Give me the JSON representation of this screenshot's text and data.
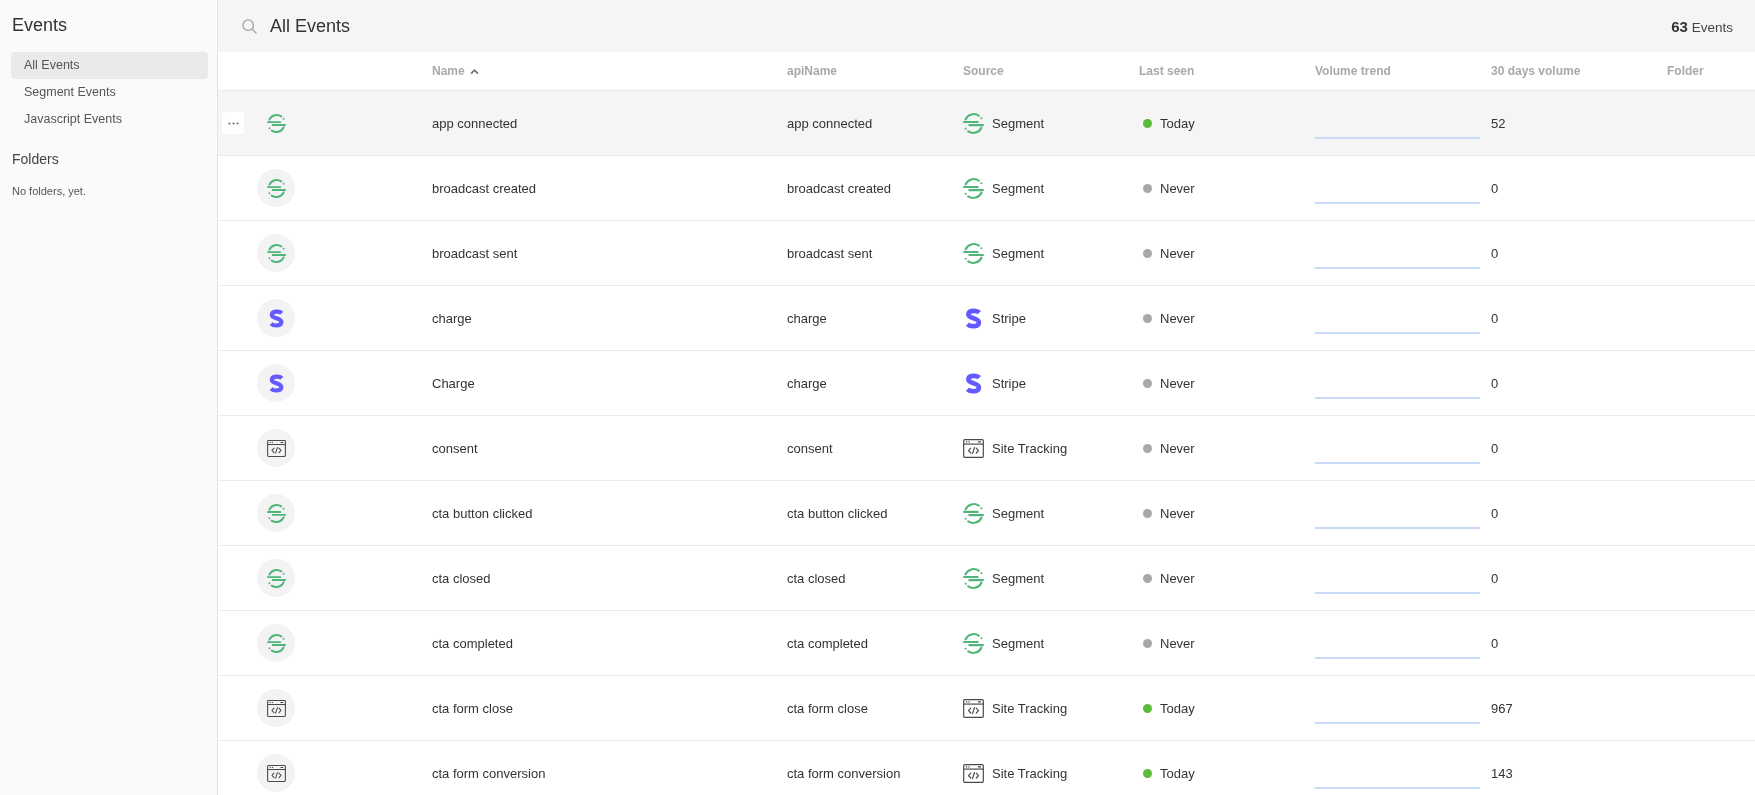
{
  "sidebar": {
    "title": "Events",
    "items": [
      {
        "label": "All Events",
        "selected": true
      },
      {
        "label": "Segment Events",
        "selected": false
      },
      {
        "label": "Javascript Events",
        "selected": false
      }
    ],
    "folders_heading": "Folders",
    "folders_empty": "No folders, yet."
  },
  "header": {
    "title": "All Events",
    "count": "**63** Events"
  },
  "table": {
    "columns": [
      {
        "label": "Name",
        "sorted": true
      },
      {
        "label": "apiName",
        "sorted": false
      },
      {
        "label": "Source",
        "sorted": false
      },
      {
        "label": "Last seen",
        "sorted": false
      },
      {
        "label": "Volume trend",
        "sorted": false
      },
      {
        "label": "30 days volume",
        "sorted": false
      },
      {
        "label": "Folder",
        "sorted": false
      }
    ],
    "rows": [
      {
        "name": "app connected",
        "api_name": "app connected",
        "source": {
          "kind": "segment",
          "label": "Segment"
        },
        "last_seen": {
          "label": "Today",
          "color": "#5cbb3c"
        },
        "volume": "52",
        "hovered": true
      },
      {
        "name": "broadcast created",
        "api_name": "broadcast created",
        "source": {
          "kind": "segment",
          "label": "Segment"
        },
        "last_seen": {
          "label": "Never",
          "color": "#a8a8a8"
        },
        "volume": "0",
        "hovered": false
      },
      {
        "name": "broadcast sent",
        "api_name": "broadcast sent",
        "source": {
          "kind": "segment",
          "label": "Segment"
        },
        "last_seen": {
          "label": "Never",
          "color": "#a8a8a8"
        },
        "volume": "0",
        "hovered": false
      },
      {
        "name": "charge",
        "api_name": "charge",
        "source": {
          "kind": "stripe",
          "label": "Stripe"
        },
        "last_seen": {
          "label": "Never",
          "color": "#a8a8a8"
        },
        "volume": "0",
        "hovered": false
      },
      {
        "name": "Charge",
        "api_name": "charge",
        "source": {
          "kind": "stripe",
          "label": "Stripe"
        },
        "last_seen": {
          "label": "Never",
          "color": "#a8a8a8"
        },
        "volume": "0",
        "hovered": false
      },
      {
        "name": "consent",
        "api_name": "consent",
        "source": {
          "kind": "site_tracking",
          "label": "Site Tracking"
        },
        "last_seen": {
          "label": "Never",
          "color": "#a8a8a8"
        },
        "volume": "0",
        "hovered": false
      },
      {
        "name": "cta button clicked",
        "api_name": "cta button clicked",
        "source": {
          "kind": "segment",
          "label": "Segment"
        },
        "last_seen": {
          "label": "Never",
          "color": "#a8a8a8"
        },
        "volume": "0",
        "hovered": false
      },
      {
        "name": "cta closed",
        "api_name": "cta closed",
        "source": {
          "kind": "segment",
          "label": "Segment"
        },
        "last_seen": {
          "label": "Never",
          "color": "#a8a8a8"
        },
        "volume": "0",
        "hovered": false
      },
      {
        "name": "cta completed",
        "api_name": "cta completed",
        "source": {
          "kind": "segment",
          "label": "Segment"
        },
        "last_seen": {
          "label": "Never",
          "color": "#a8a8a8"
        },
        "volume": "0",
        "hovered": false
      },
      {
        "name": "cta form close",
        "api_name": "cta form close",
        "source": {
          "kind": "site_tracking",
          "label": "Site Tracking"
        },
        "last_seen": {
          "label": "Today",
          "color": "#5cbb3c"
        },
        "volume": "967",
        "hovered": false
      },
      {
        "name": "cta form conversion",
        "api_name": "cta form conversion",
        "source": {
          "kind": "site_tracking",
          "label": "Site Tracking"
        },
        "last_seen": {
          "label": "Today",
          "color": "#5cbb3c"
        },
        "volume": "143",
        "hovered": false
      }
    ]
  }
}
